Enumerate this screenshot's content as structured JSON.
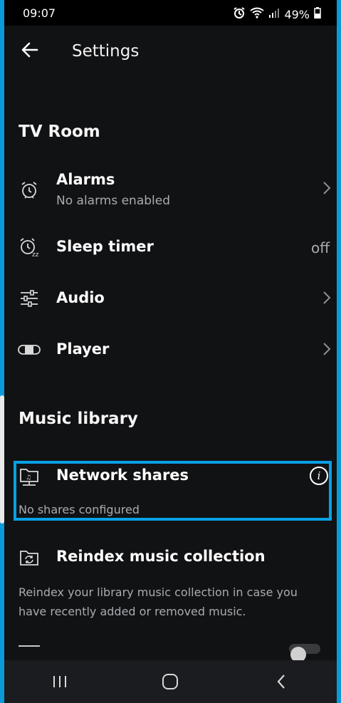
{
  "status": {
    "time": "09:07",
    "battery": "49%"
  },
  "appbar": {
    "title": "Settings"
  },
  "room": {
    "title": "TV Room",
    "items": [
      {
        "label": "Alarms",
        "sub": "No alarms enabled"
      },
      {
        "label": "Sleep timer",
        "value": "off"
      },
      {
        "label": "Audio"
      },
      {
        "label": "Player"
      }
    ]
  },
  "library": {
    "title": "Music library",
    "network": {
      "label": "Network shares",
      "sub": "No shares configured",
      "info": "i"
    },
    "reindex": {
      "label": "Reindex music collection",
      "desc": "Reindex your library music collection in case you have recently added or removed music."
    }
  },
  "colors": {
    "accent": "#0aa0e6",
    "background": "#111214",
    "muted": "#a9acb0"
  }
}
